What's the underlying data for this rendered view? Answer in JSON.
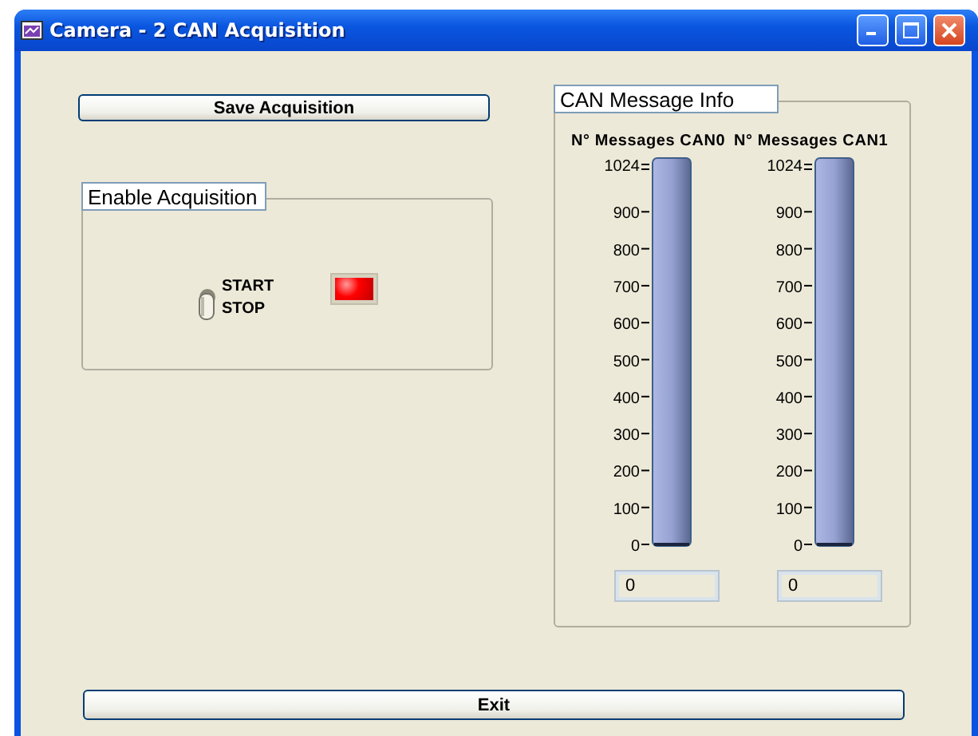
{
  "window": {
    "title": "Camera - 2 CAN Acquisition"
  },
  "save_button": {
    "label": "Save Acquisition"
  },
  "enable_acquisition": {
    "title": "Enable Acquisition",
    "switch": {
      "labels": [
        "START",
        "STOP"
      ],
      "on": false
    },
    "led": {
      "on": true
    }
  },
  "can_message_info": {
    "title": "CAN Message Info",
    "meters": [
      {
        "label": "N° Messages CAN0",
        "scale": [
          "1024",
          "900",
          "800",
          "700",
          "600",
          "500",
          "400",
          "300",
          "200",
          "100",
          "0"
        ],
        "level": 0,
        "value": "0"
      },
      {
        "label": "N° Messages CAN1",
        "scale": [
          "1024",
          "900",
          "800",
          "700",
          "600",
          "500",
          "400",
          "300",
          "200",
          "100",
          "0"
        ],
        "level": 0,
        "value": "0"
      }
    ]
  },
  "exit_button": {
    "label": "Exit"
  }
}
